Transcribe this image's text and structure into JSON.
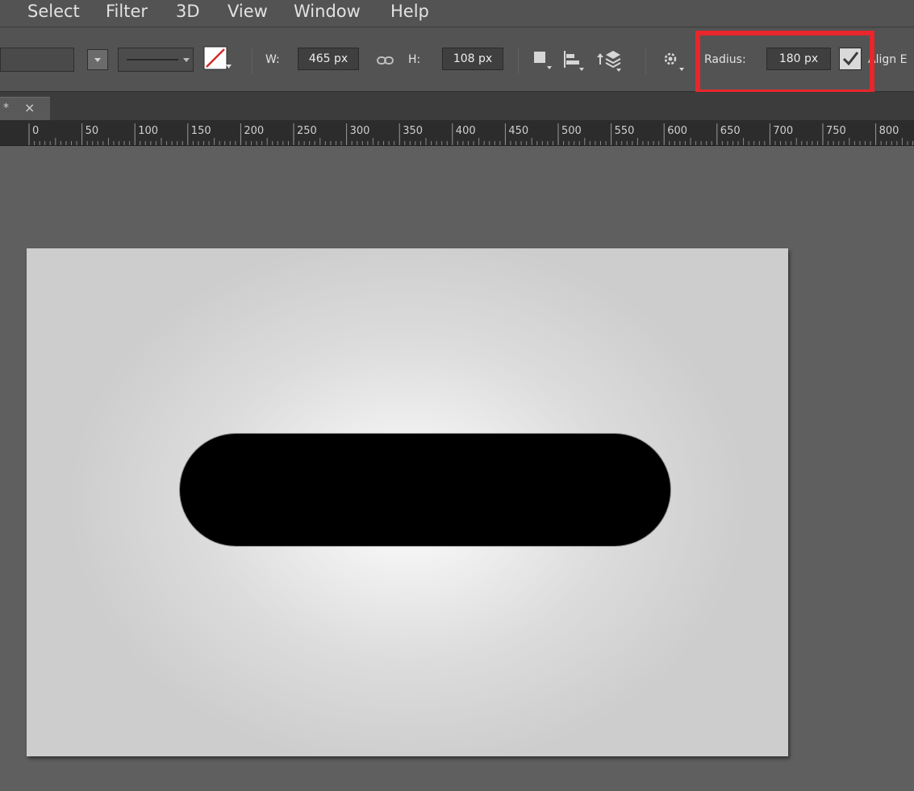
{
  "menubar": {
    "items": [
      "Select",
      "Filter",
      "3D",
      "View",
      "Window",
      "Help"
    ]
  },
  "options": {
    "width_label": "W:",
    "width_value": "465 px",
    "height_label": "H:",
    "height_value": "108 px",
    "radius_label": "Radius:",
    "radius_value": "180 px",
    "align_edges_checked": true,
    "align_label": "Align E",
    "icons": [
      "dropdown-arrow-icon",
      "stroke-style-icon",
      "stroke-color-icon",
      "link-icon",
      "path-operations-icon",
      "path-alignment-icon",
      "path-arrangement-icon",
      "gear-icon",
      "checkbox-checked-icon"
    ],
    "accent_color": "#e8262b"
  },
  "tab": {
    "title": "*",
    "close": "×"
  },
  "ruler": {
    "ticks": [
      "0",
      "50",
      "100",
      "150",
      "200",
      "250",
      "300",
      "350",
      "400",
      "450",
      "500",
      "550",
      "600",
      "650",
      "700",
      "750",
      "800"
    ]
  }
}
